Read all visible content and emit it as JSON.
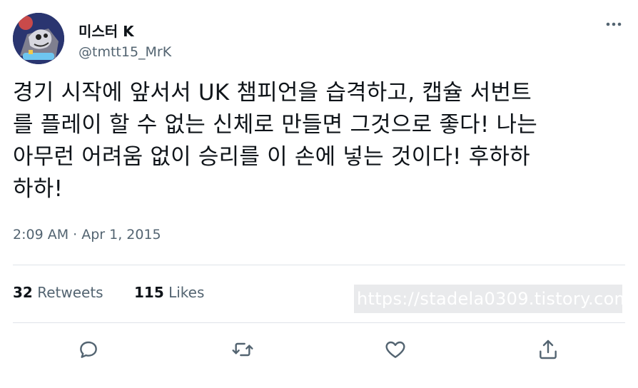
{
  "author": {
    "display_name": "미스터 K",
    "handle": "@tmtt15_MrK",
    "avatar_icon": "cartoon-character-avatar"
  },
  "tweet": {
    "lines": [
      "경기 시작에 앞서서 UK 챔피언을 습격하고, 캡슐 서번트",
      "를 플레이 할 수 없는 신체로 만들면 그것으로 좋다! 나는",
      "아무런 어려움 없이 승리를 이 손에 넣는 것이다! 후하하",
      "하하!"
    ],
    "timestamp": "2:09 AM · Apr 1, 2015"
  },
  "stats": {
    "retweets_count": "32",
    "retweets_label": "Retweets",
    "likes_count": "115",
    "likes_label": "Likes"
  },
  "watermark": "https://stadela0309.tistory.com",
  "actions": {
    "reply": "reply-icon",
    "retweet": "retweet-icon",
    "like": "heart-icon",
    "share": "share-icon"
  },
  "colors": {
    "text": "#0f1419",
    "secondary": "#536471",
    "divider": "#dfe3e8"
  }
}
